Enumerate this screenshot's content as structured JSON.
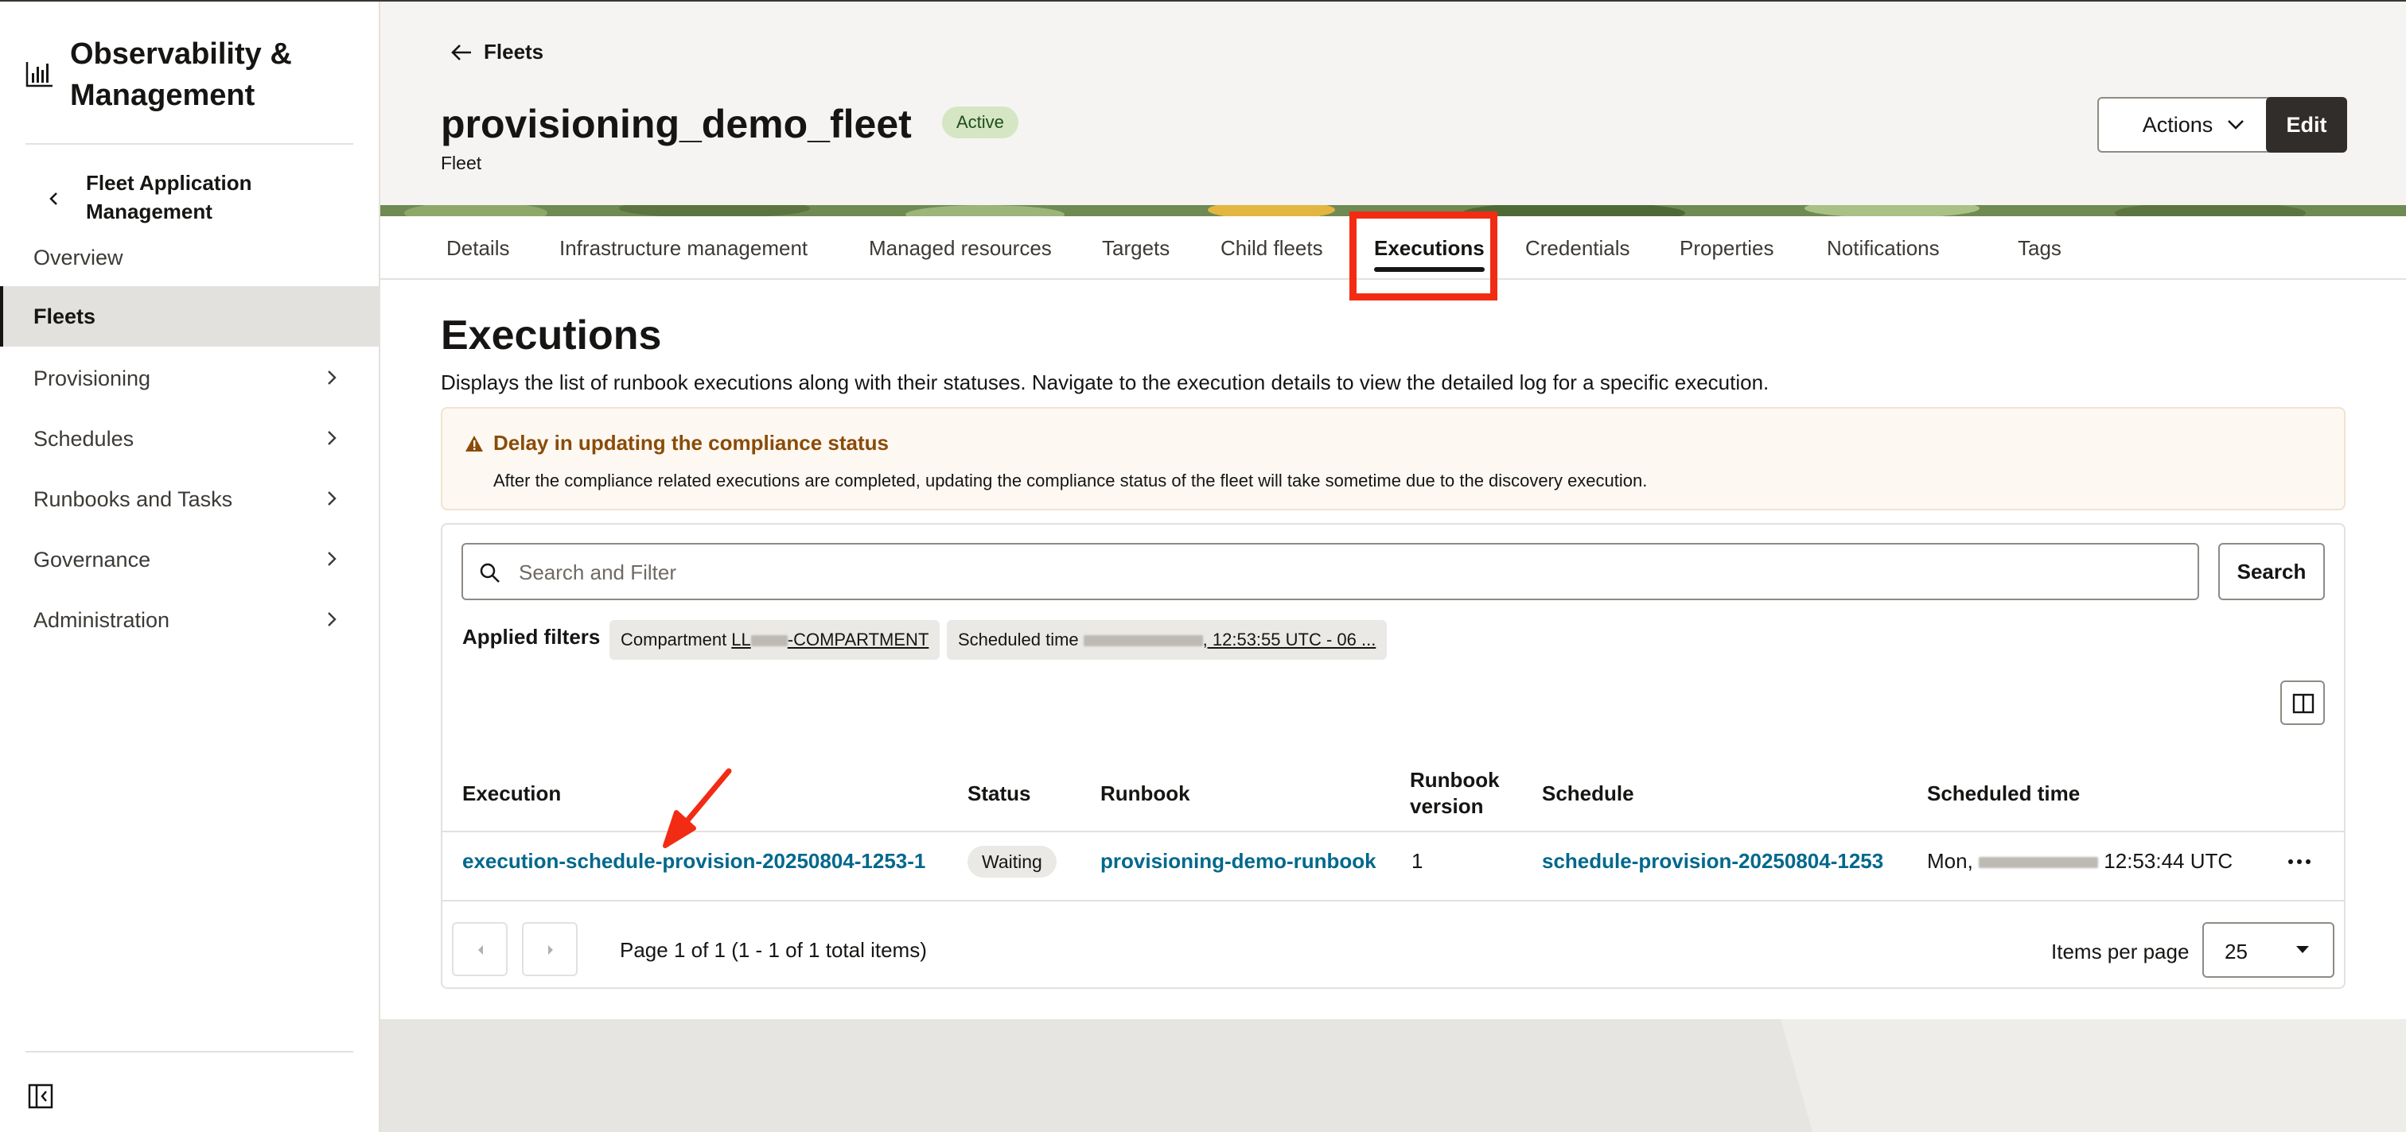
{
  "app": {
    "title": "Observability & Management"
  },
  "sidebar": {
    "section_title": "Fleet Application Management",
    "items": [
      {
        "label": "Overview",
        "active": false,
        "has_submenu": false
      },
      {
        "label": "Fleets",
        "active": true,
        "has_submenu": false
      },
      {
        "label": "Provisioning",
        "active": false,
        "has_submenu": true
      },
      {
        "label": "Schedules",
        "active": false,
        "has_submenu": true
      },
      {
        "label": "Runbooks and Tasks",
        "active": false,
        "has_submenu": true
      },
      {
        "label": "Governance",
        "active": false,
        "has_submenu": true
      },
      {
        "label": "Administration",
        "active": false,
        "has_submenu": true
      }
    ]
  },
  "header": {
    "back_label": "Fleets",
    "title": "provisioning_demo_fleet",
    "status": "Active",
    "subtitle": "Fleet",
    "actions_label": "Actions",
    "edit_label": "Edit"
  },
  "tabs": [
    {
      "label": "Details",
      "active": false
    },
    {
      "label": "Infrastructure management",
      "active": false
    },
    {
      "label": "Managed resources",
      "active": false
    },
    {
      "label": "Targets",
      "active": false
    },
    {
      "label": "Child fleets",
      "active": false
    },
    {
      "label": "Executions",
      "active": true
    },
    {
      "label": "Credentials",
      "active": false
    },
    {
      "label": "Properties",
      "active": false
    },
    {
      "label": "Notifications",
      "active": false
    },
    {
      "label": "Tags",
      "active": false
    }
  ],
  "executions": {
    "title": "Executions",
    "description": "Displays the list of runbook executions along with their statuses. Navigate to the execution details to view the detailed log for a specific execution.",
    "warning": {
      "title": "Delay in updating the compliance status",
      "text": "After the compliance related executions are completed, updating the compliance status of the fleet will take sometime due to the discovery execution."
    },
    "search": {
      "placeholder": "Search and Filter",
      "button_label": "Search"
    },
    "applied_filters": {
      "label": "Applied filters",
      "chips": [
        {
          "key": "Compartment",
          "value_prefix": "LL",
          "value_suffix": "-COMPARTMENT"
        },
        {
          "key": "Scheduled time",
          "value_suffix": ", 12:53:55 UTC - 06 ..."
        }
      ]
    },
    "table": {
      "columns": [
        "Execution",
        "Status",
        "Runbook",
        "Runbook version",
        "Schedule",
        "Scheduled time"
      ],
      "rows": [
        {
          "execution": "execution-schedule-provision-20250804-1253-1",
          "status": "Waiting",
          "runbook": "provisioning-demo-runbook",
          "runbook_version": "1",
          "schedule": "schedule-provision-20250804-1253",
          "scheduled_time_prefix": "Mon,",
          "scheduled_time_suffix": "12:53:44 UTC"
        }
      ]
    },
    "pagination": {
      "page_info": "Page 1 of 1 (1 - 1 of 1 total items)",
      "items_per_page_label": "Items per page",
      "items_per_page": "25"
    }
  },
  "colors": {
    "link": "#00688c",
    "highlight": "#f22c14",
    "active_badge_bg": "#d4e6c3",
    "warning_title": "#8a4b08",
    "primary_button": "#312d2a"
  },
  "icons": [
    "app-logo-icon",
    "chevron-left-icon",
    "chevron-right-icon",
    "arrow-left-icon",
    "chevron-down-icon",
    "warning-icon",
    "search-icon",
    "column-layout-icon",
    "more-horizontal-icon",
    "sidebar-collapse-icon"
  ]
}
